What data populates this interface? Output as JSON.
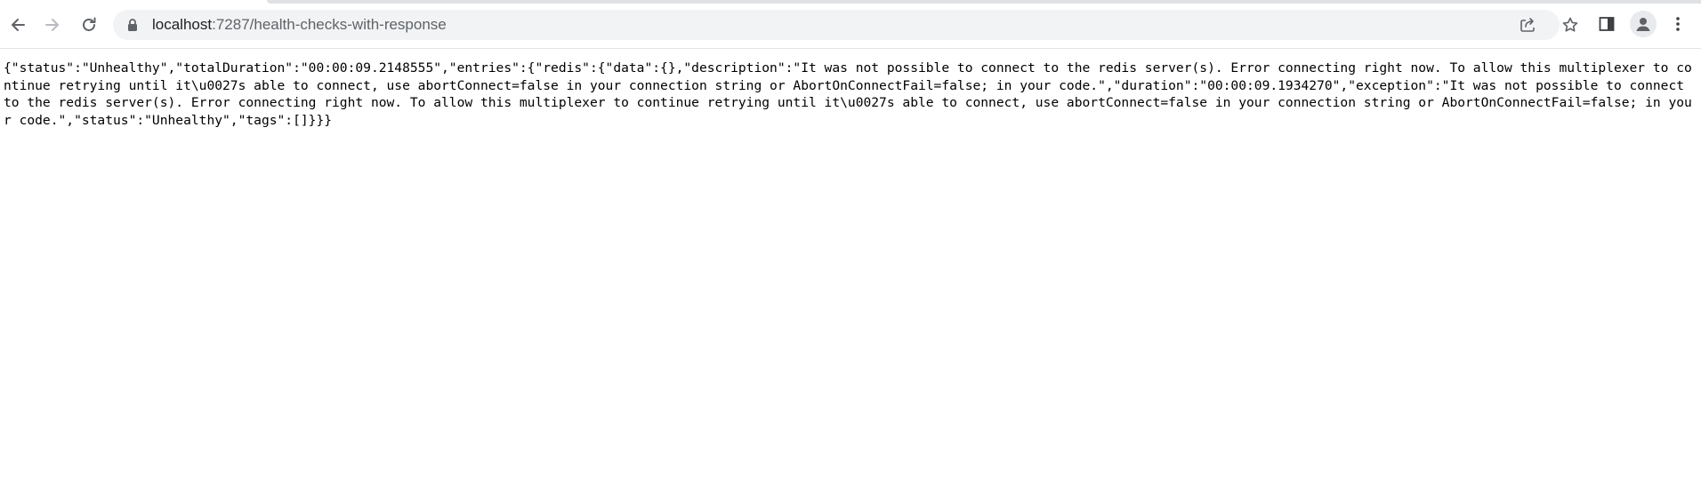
{
  "browser": {
    "address_bar": {
      "host": "localhost",
      "rest": ":7287/health-checks-with-response"
    },
    "icons": {
      "back": "back-arrow-icon",
      "forward": "forward-arrow-icon",
      "reload": "reload-icon",
      "secure": "lock-icon",
      "share": "share-icon",
      "bookmark": "star-icon",
      "side_panel": "side-panel-icon",
      "profile": "profile-avatar-icon",
      "menu": "kebab-menu-icon"
    }
  },
  "page": {
    "body_text": "{\"status\":\"Unhealthy\",\"totalDuration\":\"00:00:09.2148555\",\"entries\":{\"redis\":{\"data\":{},\"description\":\"It was not possible to connect to the redis server(s). Error connecting right now. To allow this multiplexer to continue retrying until it\\u0027s able to connect, use abortConnect=false in your connection string or AbortOnConnectFail=false; in your code.\",\"duration\":\"00:00:09.1934270\",\"exception\":\"It was not possible to connect to the redis server(s). Error connecting right now. To allow this multiplexer to continue retrying until it\\u0027s able to connect, use abortConnect=false in your connection string or AbortOnConnectFail=false; in your code.\",\"status\":\"Unhealthy\",\"tags\":[]}}}"
  }
}
